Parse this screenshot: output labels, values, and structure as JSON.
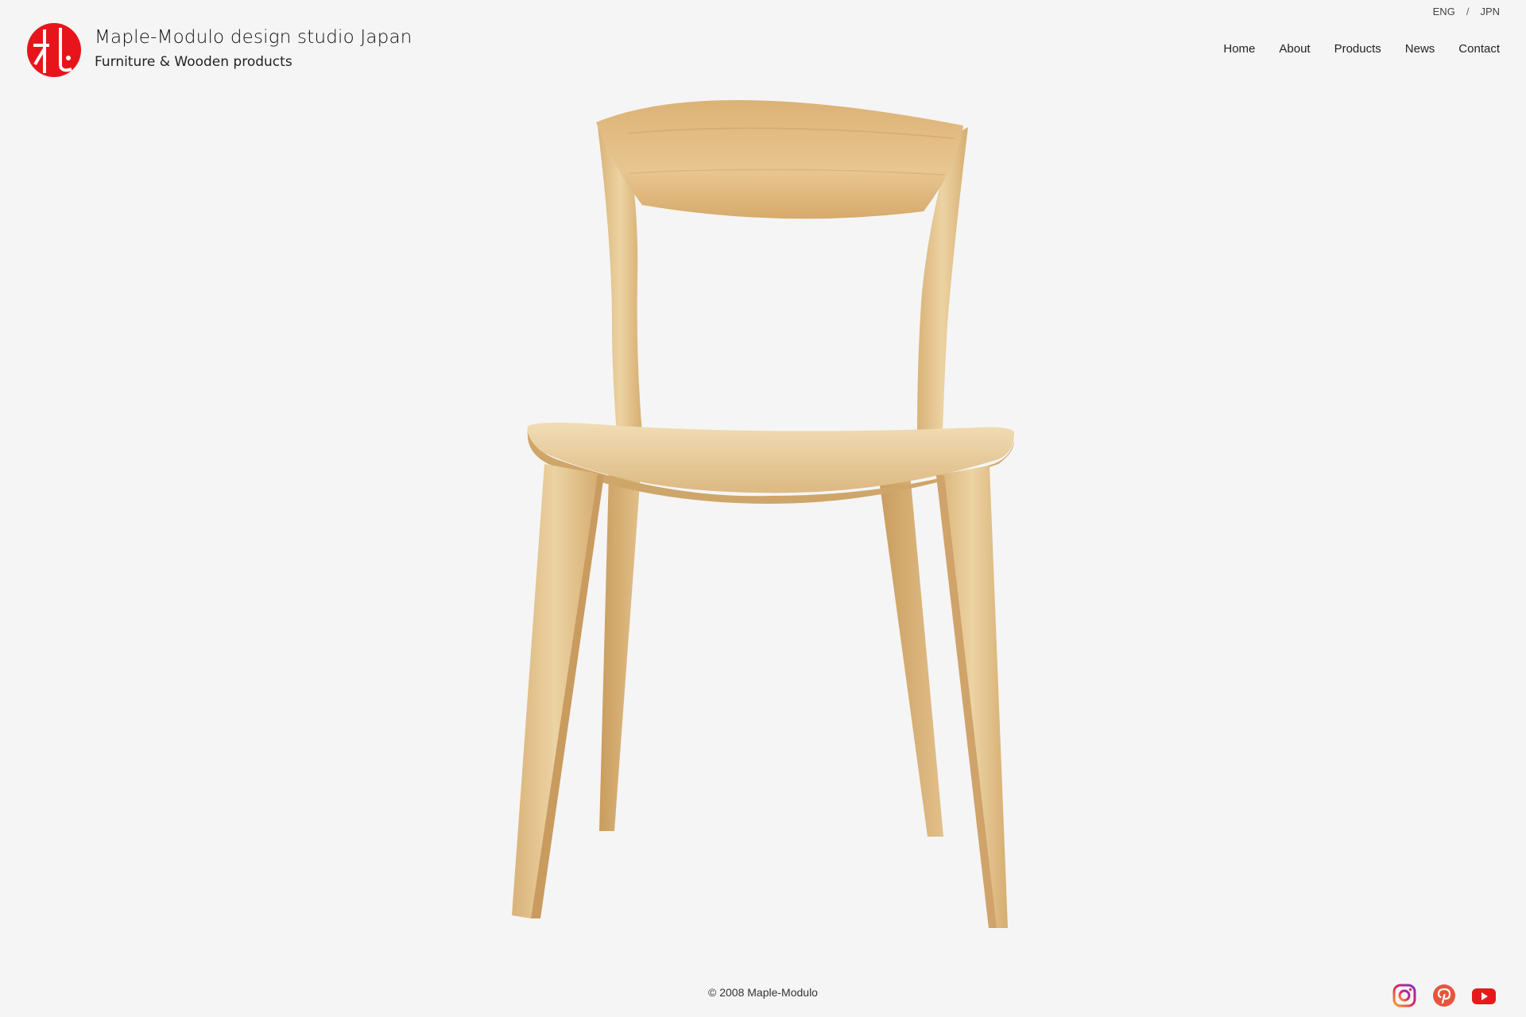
{
  "brand": {
    "title": "Maple-Modulo design studio Japan",
    "subtitle": "Furniture & Wooden products",
    "logo_color": "#e8141b"
  },
  "language": {
    "options": [
      "ENG",
      "JPN"
    ],
    "separator": "/"
  },
  "nav": {
    "items": [
      "Home",
      "About",
      "Products",
      "News",
      "Contact"
    ]
  },
  "hero": {
    "image": "wooden-chair",
    "wood_color": "#e4c48f"
  },
  "footer": {
    "copyright": "© 2008 Maple-Modulo"
  },
  "social": {
    "icons": [
      "instagram-icon",
      "pinterest-icon",
      "youtube-icon"
    ],
    "colors": {
      "pinterest": "#e8553e",
      "youtube": "#e61a1a"
    }
  }
}
